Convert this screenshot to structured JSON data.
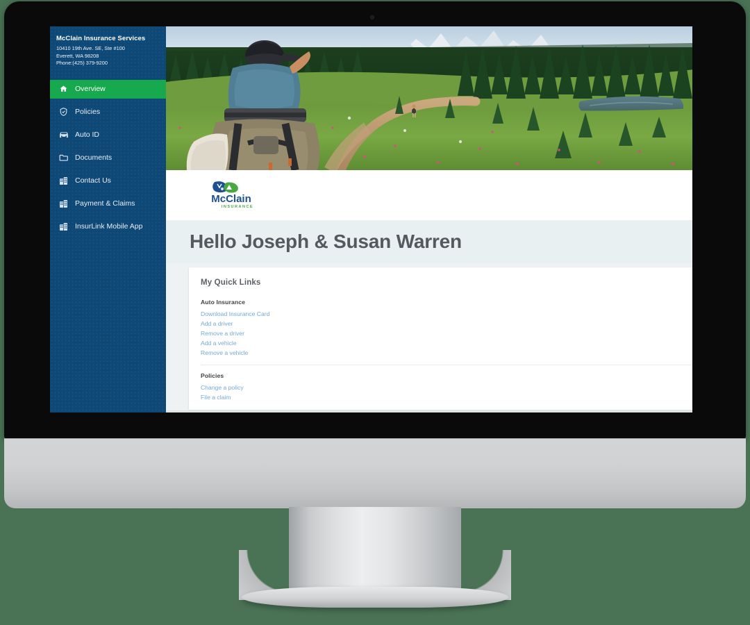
{
  "scene": {
    "background_color": "#4a7355",
    "device": "imac-desktop-monitor",
    "bezel_color": "#0a0a0a",
    "chin_color": "#cfd1d3"
  },
  "sidebar": {
    "background_color": "#0e4876",
    "active_color": "#16a94d",
    "brand": {
      "name": "McClain Insurance Services",
      "address_line1": "10410 19th Ave. SE, Ste #100",
      "address_line2": "Everett, WA 98208",
      "phone": "Phone:(425) 379-9200"
    },
    "items": [
      {
        "label": "Overview",
        "icon": "home-icon",
        "active": true
      },
      {
        "label": "Policies",
        "icon": "shield-check-icon",
        "active": false
      },
      {
        "label": "Auto ID",
        "icon": "car-icon",
        "active": false
      },
      {
        "label": "Documents",
        "icon": "folder-icon",
        "active": false
      },
      {
        "label": "Contact Us",
        "icon": "building-icon",
        "active": false
      },
      {
        "label": "Payment & Claims",
        "icon": "building-icon",
        "active": false
      },
      {
        "label": "InsurLink Mobile App",
        "icon": "building-icon",
        "active": false
      }
    ]
  },
  "hero": {
    "alt": "Family hiking on an alpine meadow trail with a child in a backpack carrier, evergreen forest, mountain lake and snowy peaks",
    "icon": "hero-photo"
  },
  "logo": {
    "word": "McClain",
    "sub": "INSURANCE",
    "mark_blue": "#1d4f91",
    "mark_green": "#4aa842"
  },
  "greeting": {
    "text": "Hello Joseph & Susan Warren",
    "band_color": "#e8f0f1",
    "text_color": "#54595f"
  },
  "quick_links": {
    "title": "My Quick Links",
    "link_color": "#74a9d8",
    "groups": [
      {
        "heading": "Auto Insurance",
        "links": [
          "Download Insurance Card",
          "Add a driver",
          "Remove a driver",
          "Add a vehicle",
          "Remove a vehicle"
        ]
      },
      {
        "heading": "Policies",
        "links": [
          "Change a policy",
          "File a claim"
        ]
      }
    ]
  }
}
